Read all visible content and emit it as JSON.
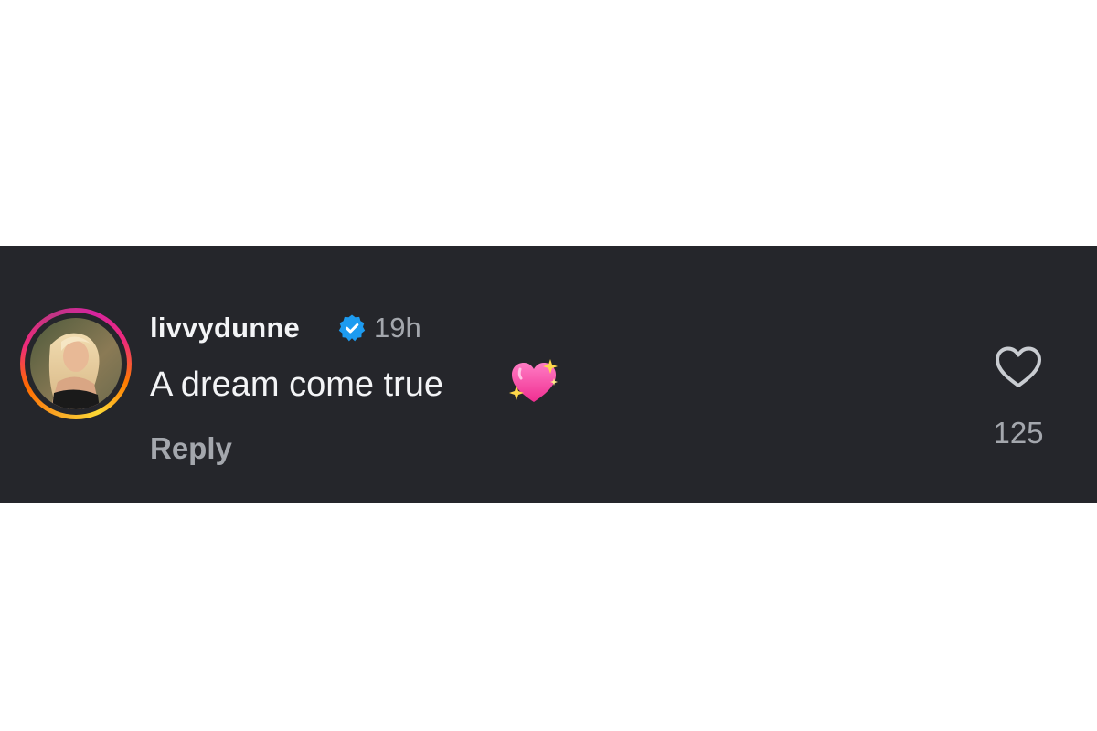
{
  "comment": {
    "username": "livvydunne",
    "verified": true,
    "timestamp": "19h",
    "text": "A dream come true",
    "emoji": "sparkling-heart",
    "reply_label": "Reply",
    "like_count": "125"
  },
  "colors": {
    "card_background": "#25262b",
    "page_background": "#ffffff",
    "primary_text": "#f3f4f6",
    "secondary_text": "#a4a7ad",
    "verified_badge": "#1d9bf0",
    "heart_emoji": "#ff4fa8"
  },
  "icons": {
    "verified": "verified-badge-icon",
    "like": "heart-outline-icon",
    "emoji": "sparkling-heart-emoji"
  }
}
